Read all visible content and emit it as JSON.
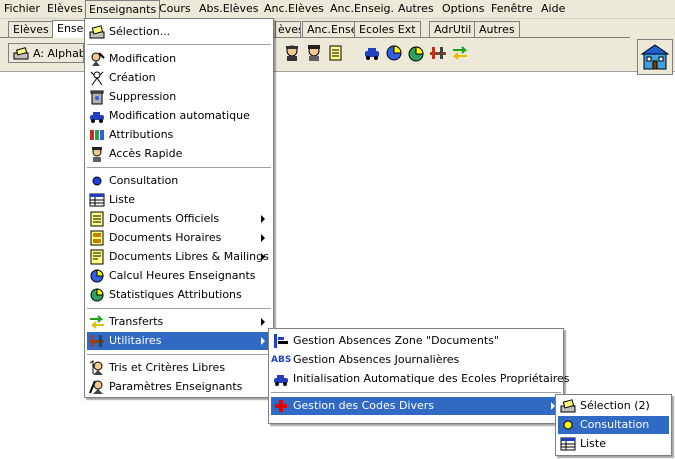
{
  "menubar": {
    "items": [
      "Fichier",
      "Elèves",
      "Enseignants",
      "Cours",
      "Abs.Elèves",
      "Anc.Elèves",
      "Anc.Enseig.",
      "Autres",
      "Options",
      "Fenêtre",
      "Aide"
    ]
  },
  "tabs": [
    "Elèves",
    "Ensei",
    "èves",
    "Anc.Enseig",
    "Ecoles Ext",
    "AdrUtil",
    "Autres"
  ],
  "toolbar": {
    "sort_label": "A: Alphabe"
  },
  "main_menu": {
    "items": [
      {
        "label": "Sélection..."
      },
      {
        "label": "Modification"
      },
      {
        "label": "Création"
      },
      {
        "label": "Suppression"
      },
      {
        "label": "Modification automatique"
      },
      {
        "label": "Attributions"
      },
      {
        "label": "Accès Rapide"
      },
      {
        "label": "Consultation"
      },
      {
        "label": "Liste"
      },
      {
        "label": "Documents Officiels"
      },
      {
        "label": "Documents Horaires"
      },
      {
        "label": "Documents Libres & Mailings"
      },
      {
        "label": "Calcul Heures Enseignants"
      },
      {
        "label": "Statistiques Attributions"
      },
      {
        "label": "Transferts"
      },
      {
        "label": "Utilitaires"
      },
      {
        "label": "Tris et Critères Libres"
      },
      {
        "label": "Paramètres Enseignants"
      }
    ]
  },
  "utilitaires_menu": {
    "items": [
      {
        "label": "Gestion Absences Zone \"Documents\""
      },
      {
        "label": "Gestion Absences Journalières"
      },
      {
        "label": "Initialisation Automatique des Ecoles Propriétaires"
      },
      {
        "label": "Gestion des Codes Divers"
      }
    ],
    "abs_icon_text": "ABS"
  },
  "codes_menu": {
    "items": [
      {
        "label": "Sélection (2)"
      },
      {
        "label": "Consultation"
      },
      {
        "label": "Liste"
      }
    ]
  },
  "colors": {
    "highlight": "#316ac5",
    "menu_bg": "#ffffff",
    "chrome": "#ece9d8"
  }
}
